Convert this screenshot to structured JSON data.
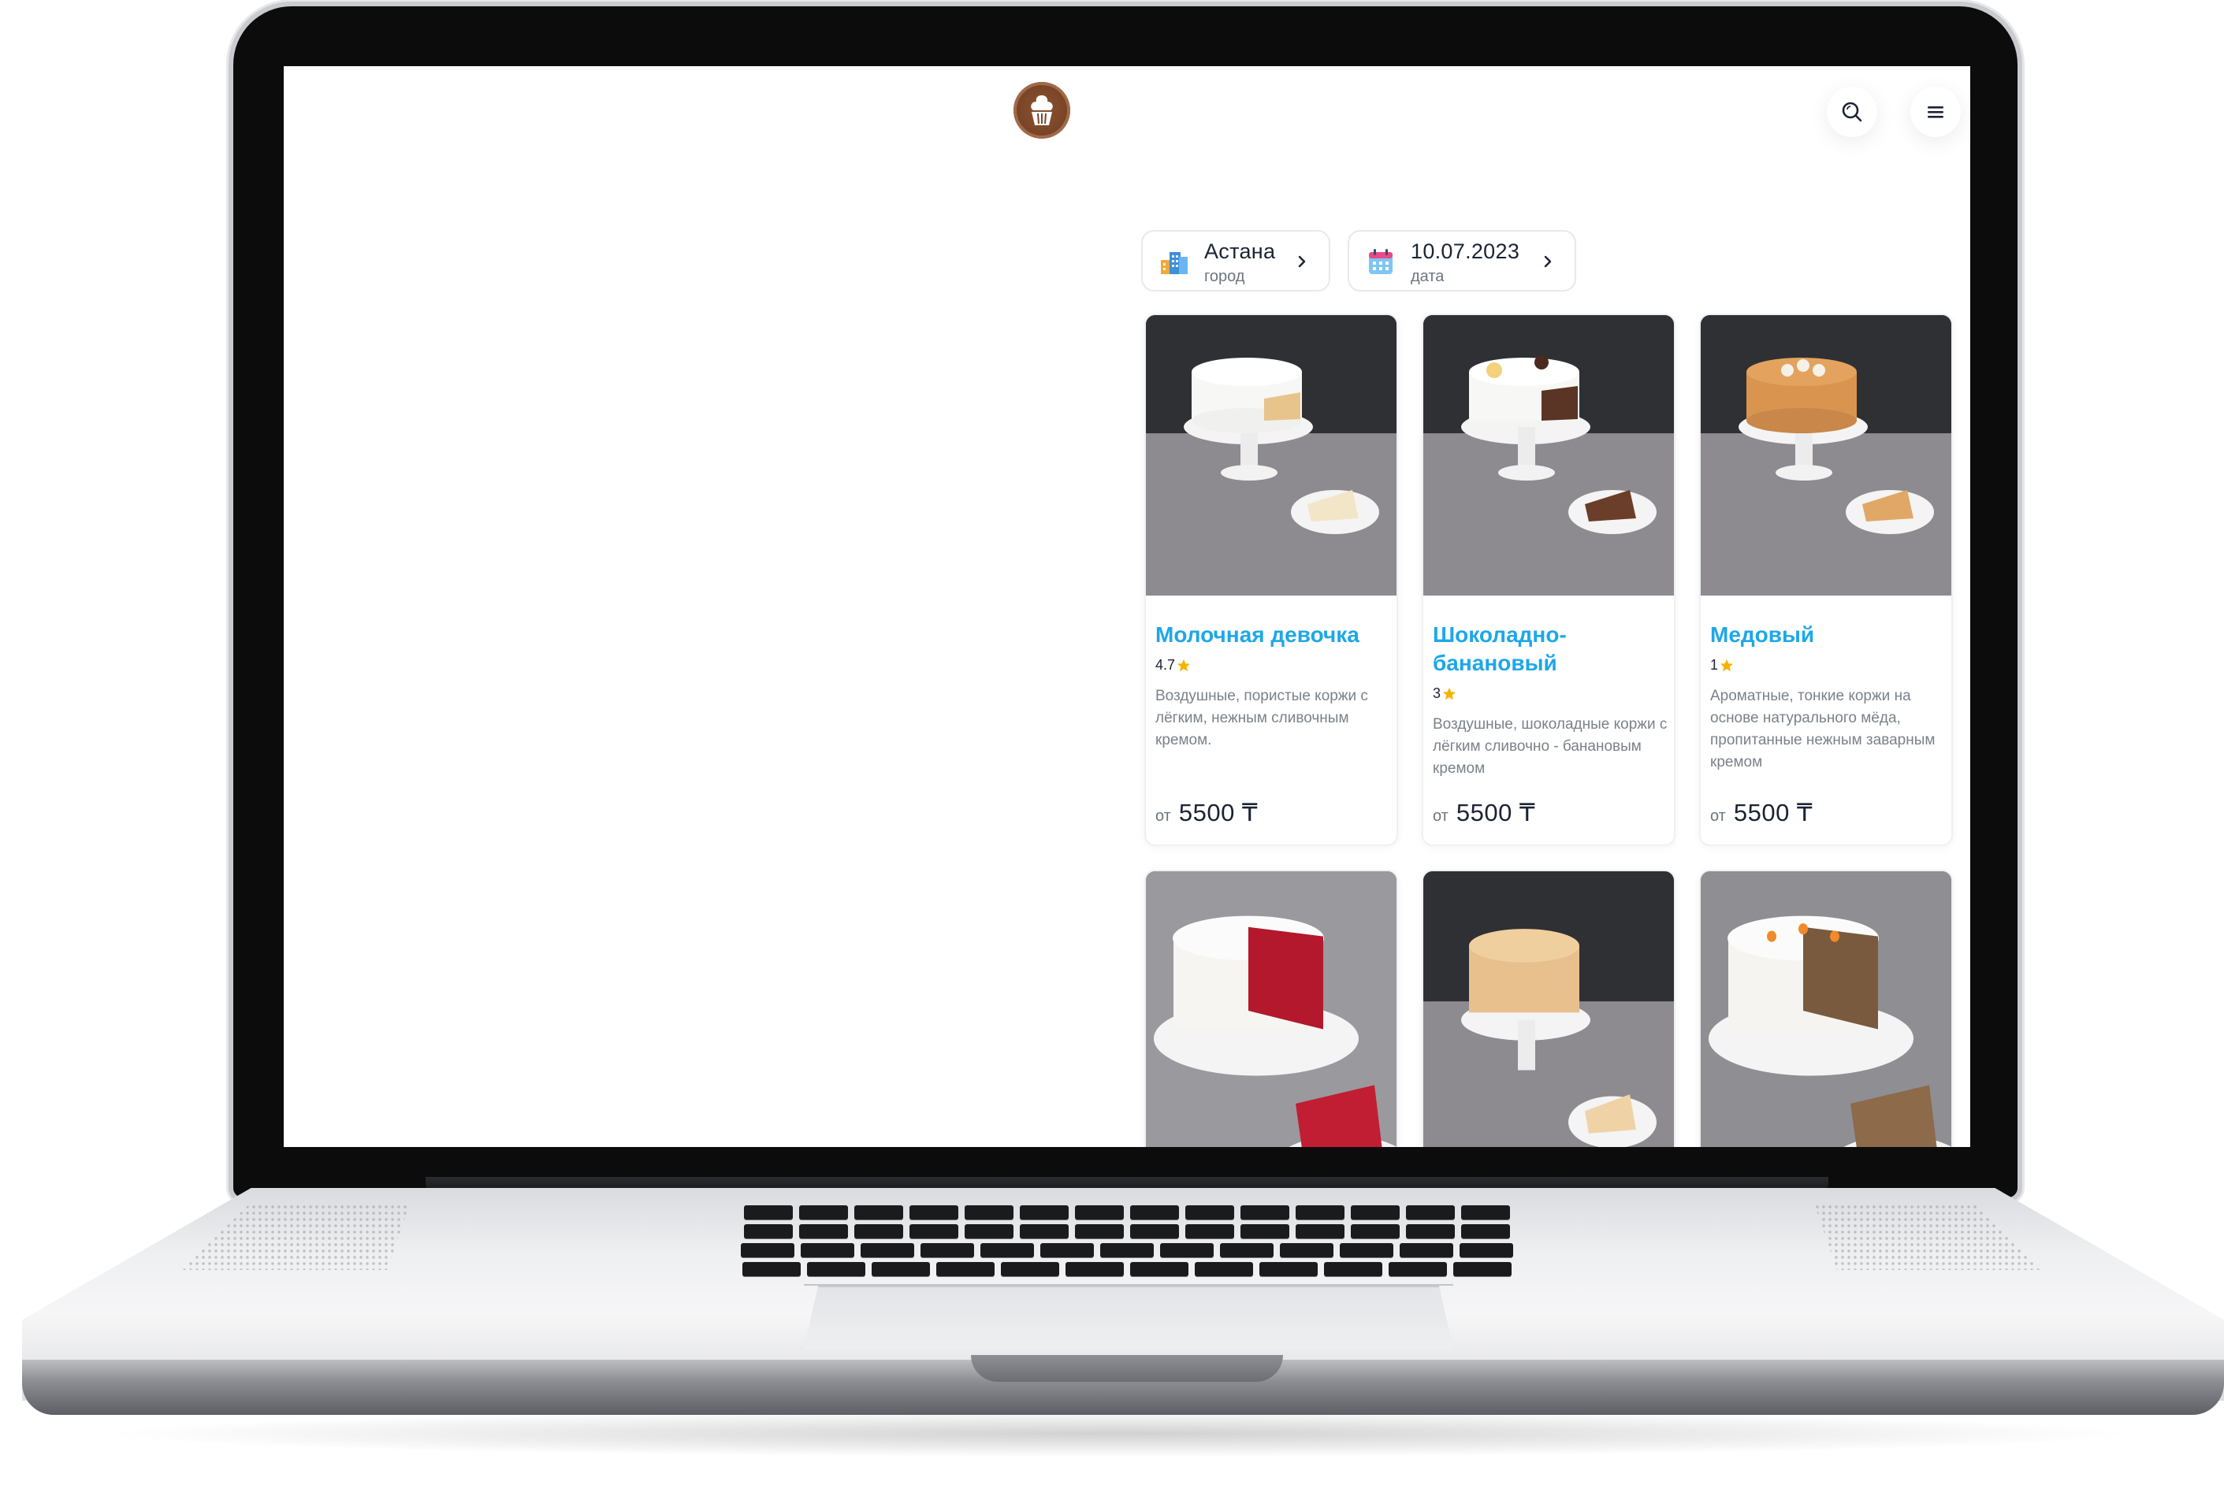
{
  "header": {
    "logo_icon": "cupcake-icon",
    "search_icon": "search-icon",
    "menu_icon": "hamburger-menu-icon"
  },
  "filters": {
    "city": {
      "value": "Астана",
      "label": "город",
      "icon": "city-buildings-icon"
    },
    "date": {
      "value": "10.07.2023",
      "label": "дата",
      "icon": "calendar-icon"
    }
  },
  "products": [
    {
      "name": "Молочная девочка",
      "rating": "4.7",
      "description": "Воздушные, пористые коржи с лёгким, нежным сливочным кремом.",
      "price_prefix": "от",
      "price": "5500 ₸"
    },
    {
      "name": "Шоколадно-банановый",
      "rating": "3",
      "description": "Воздушные, шоколадные коржи с лёгким сливочно - банановым кремом",
      "price_prefix": "от",
      "price": "5500 ₸"
    },
    {
      "name": "Медовый",
      "rating": "1",
      "description": "Ароматные, тонкие коржи на основе натурального мёда, пропитанные нежным заварным кремом",
      "price_prefix": "от",
      "price": "5500 ₸"
    },
    {
      "photo": "red-velvet-cake"
    },
    {
      "photo": "napoleon-cake"
    },
    {
      "photo": "carrot-cake"
    }
  ],
  "colors": {
    "accent": "#1ea7e8",
    "text": "#1b2333",
    "muted": "#7b818a",
    "star": "#f5b301",
    "logo": "#7a4527"
  }
}
